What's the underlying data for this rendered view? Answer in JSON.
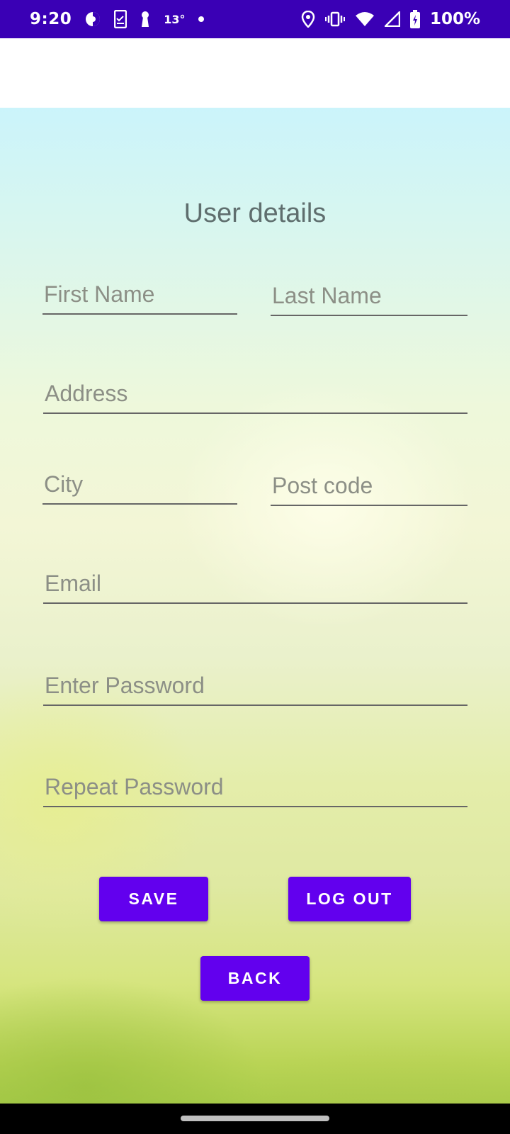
{
  "status_bar": {
    "time": "9:20",
    "temperature": "13°",
    "battery": "100%",
    "icons_left": [
      "data-saver-icon",
      "clipboard-icon",
      "keyhole-icon",
      "temperature",
      "dot-icon"
    ],
    "icons_right": [
      "location-icon",
      "vibrate-icon",
      "wifi-icon",
      "signal-icon",
      "battery-charging-icon"
    ],
    "color": "#3a00b5"
  },
  "page": {
    "title": "User details"
  },
  "form": {
    "first_name_placeholder": "First Name",
    "last_name_placeholder": "Last Name",
    "address_placeholder": "Address",
    "city_placeholder": "City",
    "post_code_placeholder": "Post code",
    "email_placeholder": "Email",
    "password_placeholder": "Enter Password",
    "repeat_password_placeholder": "Repeat Password"
  },
  "buttons": {
    "save": "SAVE",
    "logout": "LOG OUT",
    "back": "BACK",
    "color": "#6200ee"
  }
}
